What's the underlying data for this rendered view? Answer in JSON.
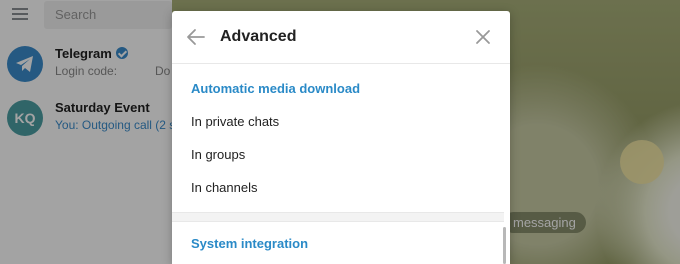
{
  "search": {
    "placeholder": "Search"
  },
  "chats": [
    {
      "avatar_type": "logo",
      "title": "Telegram",
      "verified": true,
      "subtitle": "Login code:",
      "extra": "Do"
    },
    {
      "avatar_text": "KQ",
      "title": "Saturday Event",
      "subtitle": "You: Outgoing call (2 s"
    }
  ],
  "background": {
    "pill_text": "messaging"
  },
  "dialog": {
    "title": "Advanced",
    "sections": [
      {
        "title": "Automatic media download",
        "options": [
          "In private chats",
          "In groups",
          "In channels"
        ]
      },
      {
        "title": "System integration"
      }
    ]
  },
  "colors": {
    "accent": "#2a8ac7",
    "telegram_avatar": "#3a8ccb",
    "kq_avatar": "#4c9fa3"
  }
}
